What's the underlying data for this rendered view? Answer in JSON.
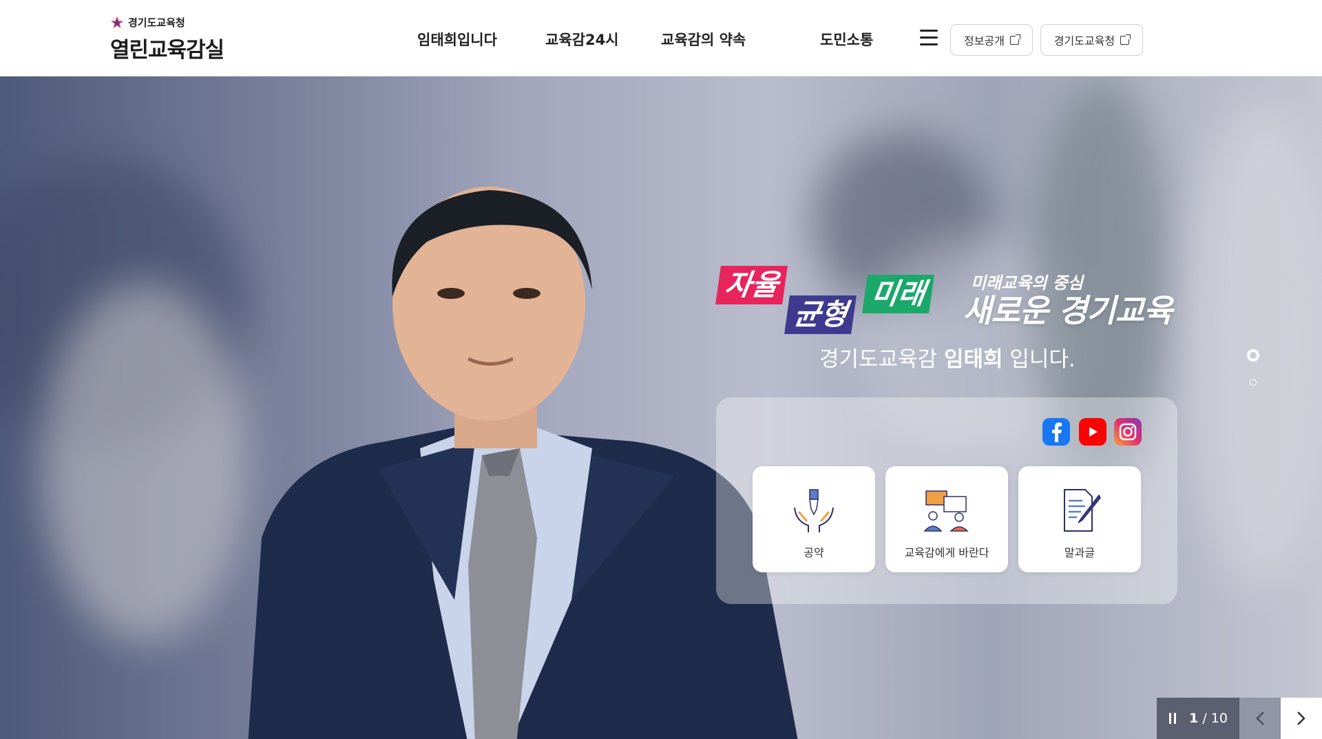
{
  "header": {
    "org_name": "경기도교육청",
    "site_title": "열린교육감실",
    "nav": [
      "임태희입니다",
      "교육감24시",
      "교육감의 약속",
      "도민소통"
    ],
    "ext_links": [
      "정보공개",
      "경기도교육청"
    ]
  },
  "hero": {
    "tags": [
      "자율",
      "균형",
      "미래"
    ],
    "sub_slogan": "미래교육의 중심",
    "main_slogan": "새로운 경기교육",
    "greeting_prefix": "경기도교육감",
    "greeting_name": "임태희",
    "greeting_suffix": "입니다.",
    "sns": [
      "facebook-icon",
      "youtube-icon",
      "instagram-icon"
    ],
    "quick_links": [
      "공약",
      "교육감에게 바란다",
      "말과글"
    ],
    "slide_current": "1",
    "slide_total": "10",
    "slide_separator": "/"
  },
  "colors": {
    "tag_red": "#e8245c",
    "tag_purple": "#3f3a8f",
    "tag_green": "#1aa86b",
    "facebook": "#1877f2",
    "youtube": "#ff0000",
    "instagram": "#d6249f"
  }
}
